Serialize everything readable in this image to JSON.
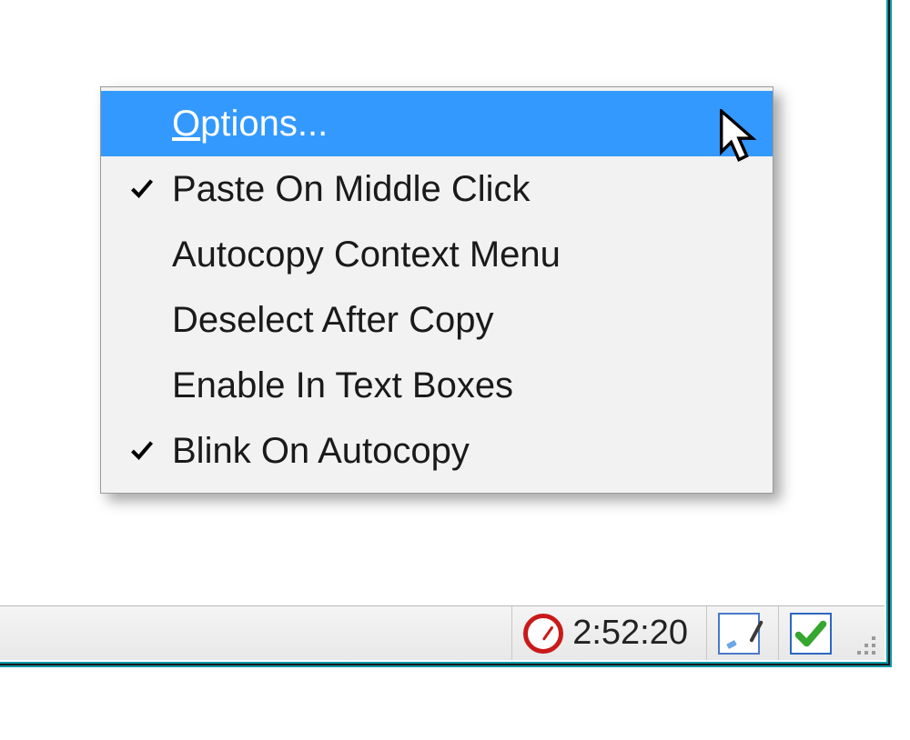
{
  "menu": {
    "items": [
      {
        "label": "Options...",
        "accelChar": "O",
        "checked": false,
        "highlighted": true
      },
      {
        "label": "Paste On Middle Click",
        "checked": true,
        "highlighted": false
      },
      {
        "label": "Autocopy Context Menu",
        "checked": false,
        "highlighted": false
      },
      {
        "label": "Deselect After Copy",
        "checked": false,
        "highlighted": false
      },
      {
        "label": "Enable In Text Boxes",
        "checked": false,
        "highlighted": false
      },
      {
        "label": "Blink On Autocopy",
        "checked": true,
        "highlighted": false
      }
    ]
  },
  "statusbar": {
    "time": "2:52:20"
  }
}
